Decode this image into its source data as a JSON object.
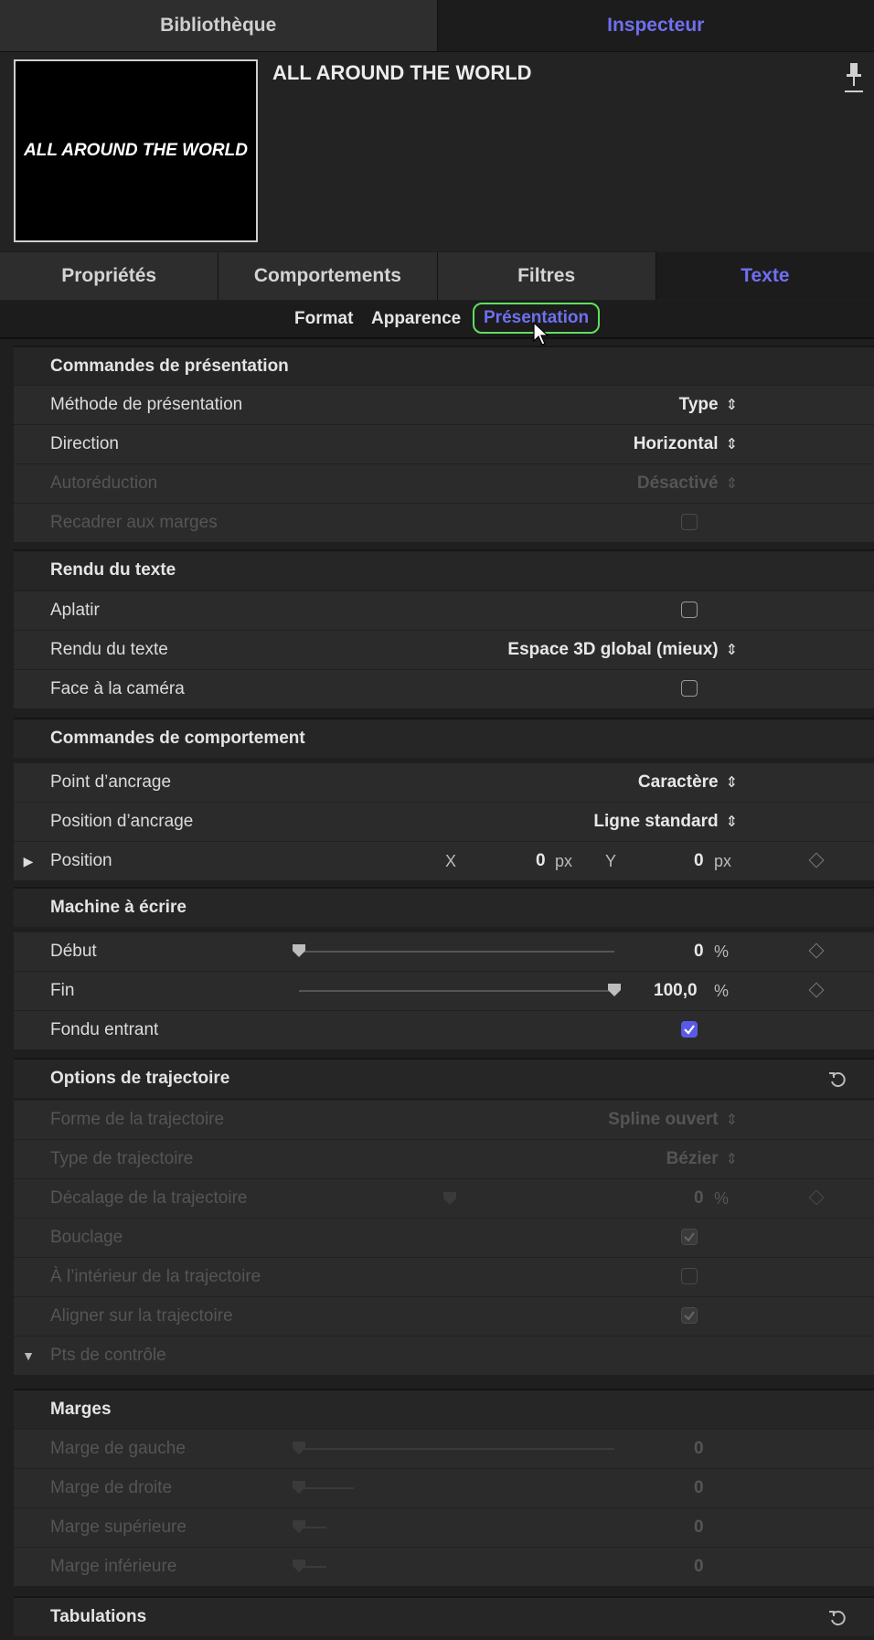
{
  "top_tabs": {
    "library": "Bibliothèque",
    "inspector": "Inspecteur"
  },
  "clip": {
    "title": "ALL AROUND THE WORLD",
    "thumbnail_text": "ALL AROUND THE WORLD"
  },
  "inspector_tabs": [
    "Propriétés",
    "Comportements",
    "Filtres",
    "Texte"
  ],
  "sub_tabs": {
    "format": "Format",
    "appearance": "Apparence",
    "layout": "Présentation"
  },
  "sections": {
    "layout_controls": "Commandes de présentation",
    "text_render": "Rendu du texte",
    "behavior_controls": "Commandes de comportement",
    "typewriter": "Machine à écrire",
    "path_options": "Options de trajectoire",
    "margins": "Marges",
    "tabs": "Tabulations"
  },
  "rows": {
    "layout_method": {
      "label": "Méthode de présentation",
      "value": "Type"
    },
    "direction": {
      "label": "Direction",
      "value": "Horizontal"
    },
    "autoshrink": {
      "label": "Autoréduction",
      "value": "Désactivé"
    },
    "crop_margins": {
      "label": "Recadrer aux marges"
    },
    "flatten": {
      "label": "Aplatir"
    },
    "render": {
      "label": "Rendu du texte",
      "value": "Espace 3D global (mieux)"
    },
    "face_camera": {
      "label": "Face à la caméra"
    },
    "anchor_point": {
      "label": "Point d’ancrage",
      "value": "Caractère"
    },
    "anchor_position": {
      "label": "Position d’ancrage",
      "value": "Ligne standard"
    },
    "position": {
      "label": "Position",
      "x_axis": "X",
      "x": "0",
      "x_unit": "px",
      "y_axis": "Y",
      "y": "0",
      "y_unit": "px"
    },
    "start": {
      "label": "Début",
      "value": "0",
      "unit": "%",
      "slider": 0.0
    },
    "end": {
      "label": "Fin",
      "value": "100,0",
      "unit": "%",
      "slider": 1.0
    },
    "fade_in": {
      "label": "Fondu entrant",
      "checked": true
    },
    "path_shape": {
      "label": "Forme de la trajectoire",
      "value": "Spline ouvert"
    },
    "path_type": {
      "label": "Type de trajectoire",
      "value": "Bézier"
    },
    "path_offset": {
      "label": "Décalage de la trajectoire",
      "value": "0",
      "unit": "%"
    },
    "loop": {
      "label": "Bouclage"
    },
    "inside_path": {
      "label": "À l’intérieur de la trajectoire"
    },
    "align_path": {
      "label": "Aligner sur la trajectoire"
    },
    "control_points": {
      "label": "Pts de contrôle"
    },
    "margin_left": {
      "label": "Marge de gauche",
      "value": "0"
    },
    "margin_right": {
      "label": "Marge de droite",
      "value": "0"
    },
    "margin_top": {
      "label": "Marge supérieure",
      "value": "0"
    },
    "margin_bottom": {
      "label": "Marge inférieure",
      "value": "0"
    }
  },
  "colors": {
    "accent": "#6f6ff0",
    "highlight": "#5fe05f",
    "checkbox": "#5a5ae6"
  }
}
